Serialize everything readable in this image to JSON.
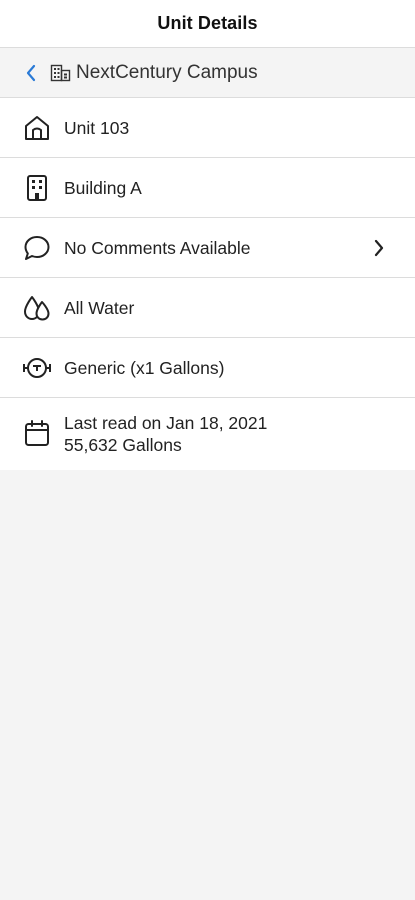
{
  "header": {
    "title": "Unit Details"
  },
  "breadcrumb": {
    "campus_label": "NextCentury Campus",
    "back_icon": "chevron-left-icon",
    "campus_icon": "building-icon"
  },
  "details": {
    "unit": {
      "label": "Unit 103",
      "icon": "home-icon"
    },
    "building": {
      "label": "Building A",
      "icon": "building-icon"
    },
    "comments": {
      "label": "No Comments Available",
      "icon": "comment-icon",
      "chevron_icon": "chevron-right-icon"
    },
    "utility": {
      "label": "All Water",
      "icon": "water-drops-icon"
    },
    "meter": {
      "label": "Generic (x1 Gallons)",
      "icon": "meter-icon"
    },
    "reading": {
      "date_line": "Last read on Jan 18, 2021",
      "value_line": "55,632 Gallons",
      "icon": "calendar-icon"
    }
  },
  "colors": {
    "accent": "#2a7ad6",
    "background": "#f4f4f4",
    "divider": "#dcdcdc"
  }
}
